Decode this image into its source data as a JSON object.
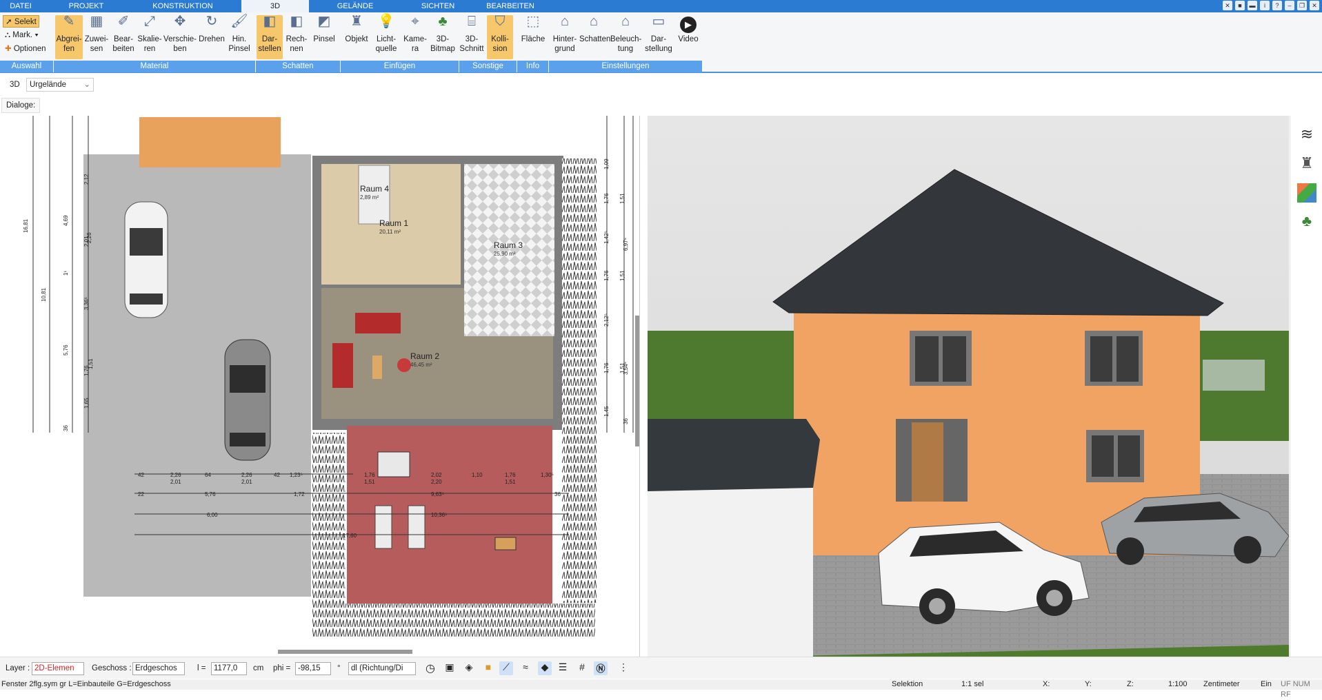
{
  "menu": {
    "tabs": [
      "DATEI",
      "PROJEKT",
      "KONSTRUKTION",
      "3D",
      "GELÄNDE",
      "SICHTEN",
      "BEARBEITEN"
    ]
  },
  "ribbon": {
    "left": {
      "selekt": "Selekt",
      "mark": "Mark.",
      "optionen": "Optionen"
    },
    "buttons": [
      {
        "l1": "Abgrei-",
        "l2": "fen"
      },
      {
        "l1": "Zuwei-",
        "l2": "sen"
      },
      {
        "l1": "Bear-",
        "l2": "beiten"
      },
      {
        "l1": "Skalie-",
        "l2": "ren"
      },
      {
        "l1": "Verschie-",
        "l2": "ben"
      },
      {
        "l1": "Drehen",
        "l2": ""
      },
      {
        "l1": "Hin.",
        "l2": "Pinsel"
      },
      {
        "l1": "Dar-",
        "l2": "stellen"
      },
      {
        "l1": "Rech-",
        "l2": "nen"
      },
      {
        "l1": "Pinsel",
        "l2": ""
      },
      {
        "l1": "Objekt",
        "l2": ""
      },
      {
        "l1": "Licht-",
        "l2": "quelle"
      },
      {
        "l1": "Kame-",
        "l2": "ra"
      },
      {
        "l1": "3D-",
        "l2": "Bitmap"
      },
      {
        "l1": "3D-",
        "l2": "Schnitt"
      },
      {
        "l1": "Kolli-",
        "l2": "sion"
      },
      {
        "l1": "Fläche",
        "l2": ""
      },
      {
        "l1": "Hinter-",
        "l2": "grund"
      },
      {
        "l1": "Schatten",
        "l2": ""
      },
      {
        "l1": "Beleuch-",
        "l2": "tung"
      },
      {
        "l1": "Dar-",
        "l2": "stellung"
      },
      {
        "l1": "Video",
        "l2": ""
      }
    ],
    "groups": [
      "Auswahl",
      "Material",
      "Schatten",
      "Einfügen",
      "Sonstige",
      "Info",
      "Einstellungen"
    ]
  },
  "subbar": {
    "mode": "3D",
    "terrain": "Urgelände"
  },
  "dialog": {
    "label": "Dialoge:"
  },
  "plan": {
    "rooms": [
      {
        "name": "Raum 4",
        "area": "2,89 m²"
      },
      {
        "name": "Raum 1",
        "area": "20,11 m²"
      },
      {
        "name": "Raum 3",
        "area": "25,90 m²"
      },
      {
        "name": "Raum 2",
        "area": "46,45 m²"
      }
    ],
    "dims_left": [
      "16,81",
      "10,81",
      "4,69",
      "2,12",
      "2,01",
      "2,26",
      "1¹",
      "3,36⁵",
      "5,76",
      "1,76",
      "1,51",
      "1,65",
      "36"
    ],
    "dims_right": [
      "1,09",
      "1,76",
      "1,51",
      "1,42⁵",
      "6,97⁵",
      "1,76",
      "1,51",
      "2,12⁵",
      "1,76",
      "1,51",
      "3,54⁵",
      "1,45",
      "36"
    ],
    "dims_bottom": [
      "42",
      "2,26",
      "64",
      "2,26",
      "42",
      "1,23⁵",
      "2,01",
      "2,01",
      "5,76",
      "1,72",
      "6,00",
      "1,76",
      "1,51",
      "2,02",
      "2,20",
      "1,10",
      "1,76",
      "1,51",
      "1,30⁵",
      "9,63⁵",
      "10,36⁵",
      "17,60",
      "36",
      "22"
    ]
  },
  "toolbox": {
    "icons": [
      "layers-icon",
      "chair-icon",
      "materials-icon",
      "tree-icon"
    ]
  },
  "bottom": {
    "layer_label": "Layer :",
    "layer_value": "2D-Elemen",
    "geschoss_label": "Geschoss :",
    "geschoss_value": "Erdgeschos",
    "l_label": "l =",
    "l_value": "1177,0",
    "l_unit": "cm",
    "phi_label": "phi =",
    "phi_value": "-98,15",
    "phi_unit": "°",
    "dl_value": "dl (Richtung/Di"
  },
  "status": {
    "left": "Fenster 2flg.sym gr L=Einbauteile G=Erdgeschoss",
    "selektion": "Selektion",
    "scale_sel": "1:1 sel",
    "x": "X:",
    "y": "Y:",
    "z": "Z:",
    "scale": "1:100",
    "unit": "Zentimeter",
    "ein": "Ein",
    "flags": "UF NUM RF"
  },
  "colors": {
    "accent": "#2b7bd3",
    "active": "#f6c76b",
    "wall": "#f1a364",
    "roof": "#33373c"
  }
}
